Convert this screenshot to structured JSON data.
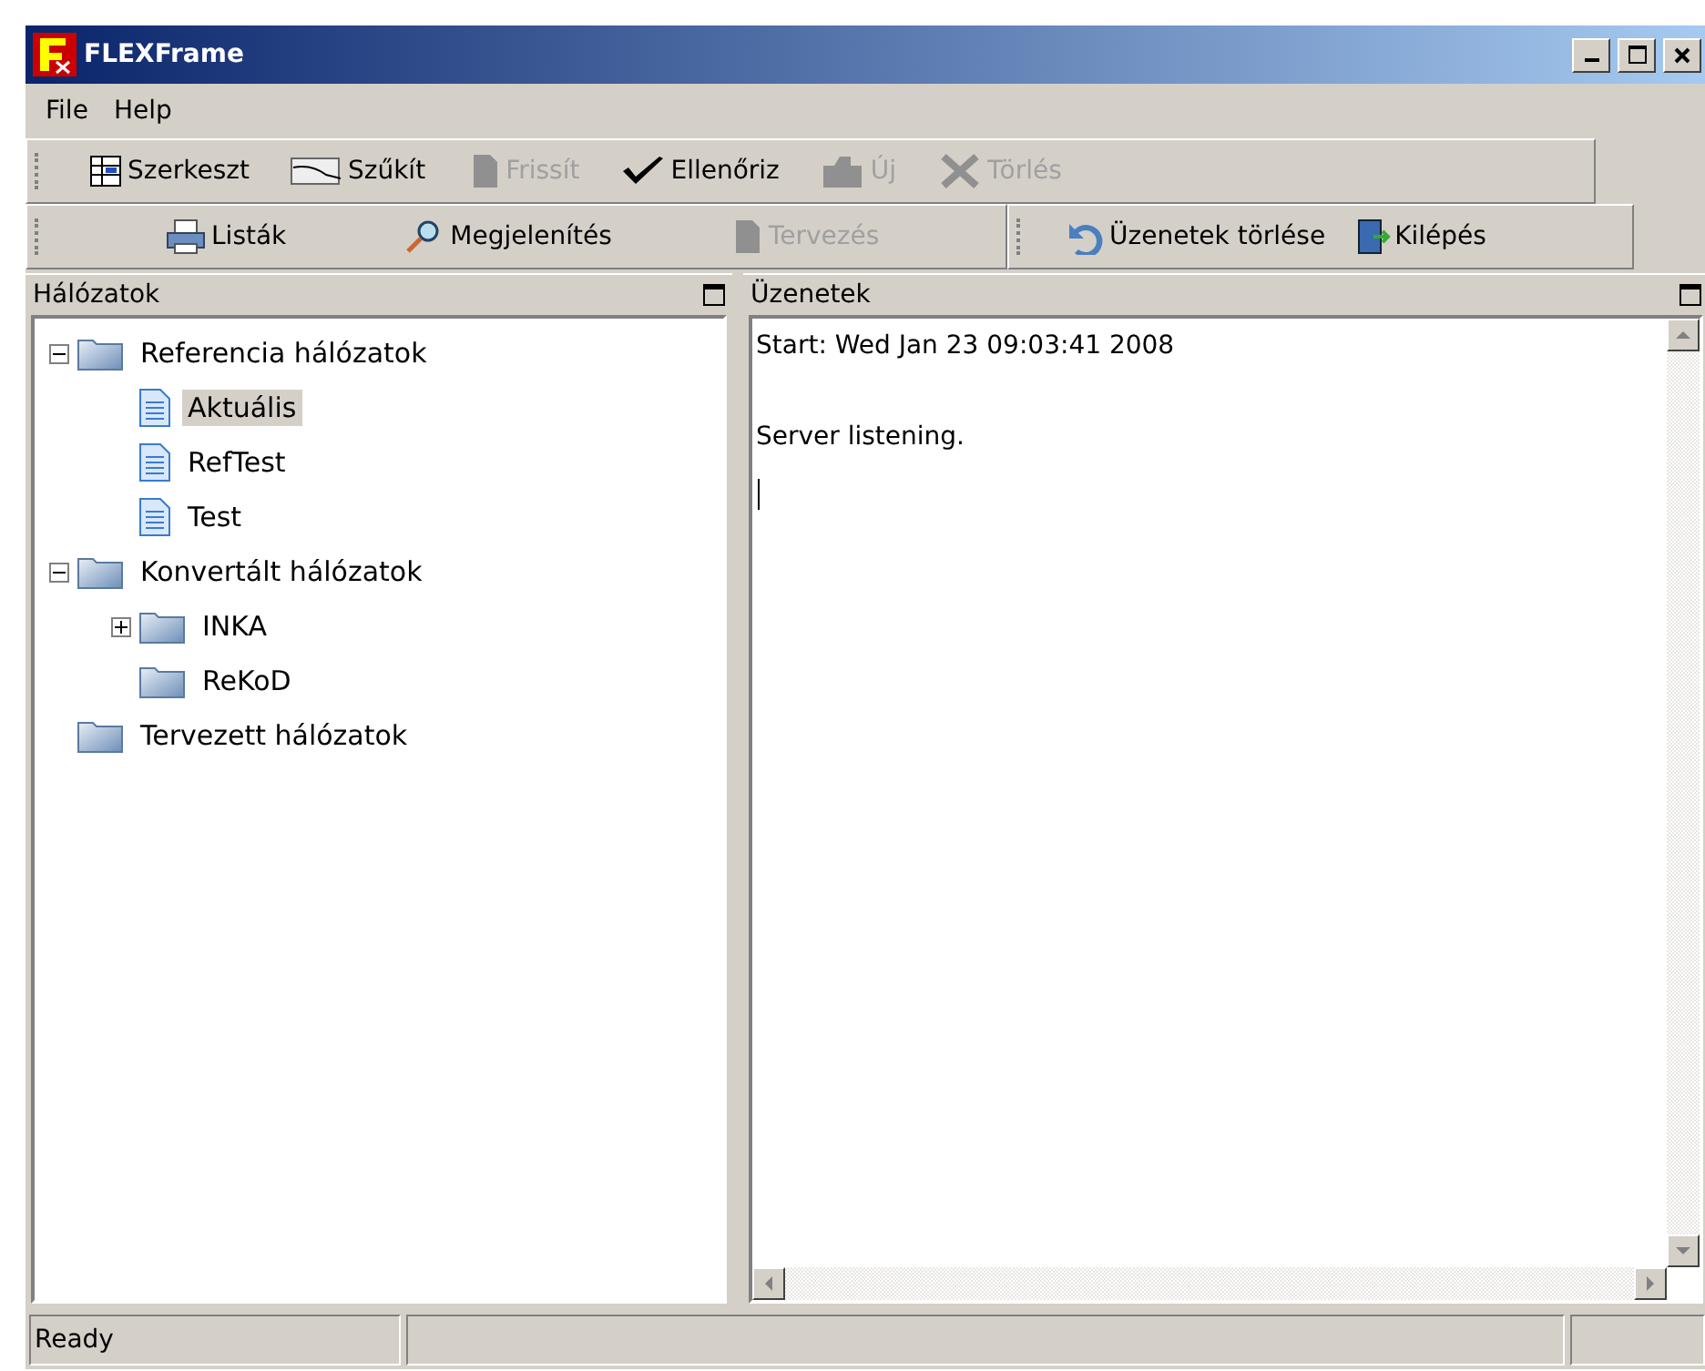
{
  "window": {
    "title": "FLEXFrame"
  },
  "menu": [
    "File",
    "Help"
  ],
  "toolbars": [
    {
      "items": [
        {
          "label": "Szerkeszt",
          "disabled": false
        },
        {
          "label": "Szűkít",
          "disabled": false
        },
        {
          "label": "Frissít",
          "disabled": true
        },
        {
          "label": "Ellenőriz",
          "disabled": false
        },
        {
          "label": "Új",
          "disabled": true
        },
        {
          "label": "Törlés",
          "disabled": true
        }
      ]
    },
    {
      "items": [
        {
          "label": "Listák",
          "disabled": false
        },
        {
          "label": "Megjelenítés",
          "disabled": false
        },
        {
          "label": "Tervezés",
          "disabled": true
        }
      ]
    },
    {
      "items": [
        {
          "label": "Üzenetek törlése",
          "disabled": false
        },
        {
          "label": "Kilépés",
          "disabled": false
        }
      ]
    }
  ],
  "tree_panel": {
    "title": "Hálózatok",
    "items": [
      {
        "label": "Referencia hálózatok",
        "kind": "folder",
        "expanded": true,
        "selected": false,
        "children": [
          {
            "label": "Aktuális",
            "kind": "document",
            "selected": true
          },
          {
            "label": "RefTest",
            "kind": "document",
            "selected": false
          },
          {
            "label": "Test",
            "kind": "document",
            "selected": false
          }
        ]
      },
      {
        "label": "Konvertált hálózatok",
        "kind": "folder",
        "expanded": true,
        "selected": false,
        "children": [
          {
            "label": "INKA",
            "kind": "folder",
            "expanded": false,
            "selected": false
          },
          {
            "label": "ReKoD",
            "kind": "folder",
            "selected": false
          }
        ]
      },
      {
        "label": "Tervezett hálózatok",
        "kind": "folder",
        "selected": false
      }
    ]
  },
  "messages_panel": {
    "title": "Üzenetek",
    "lines": [
      "Start: Wed Jan 23 09:03:41 2008",
      "Server listening."
    ]
  },
  "status_bar": [
    "Ready"
  ]
}
